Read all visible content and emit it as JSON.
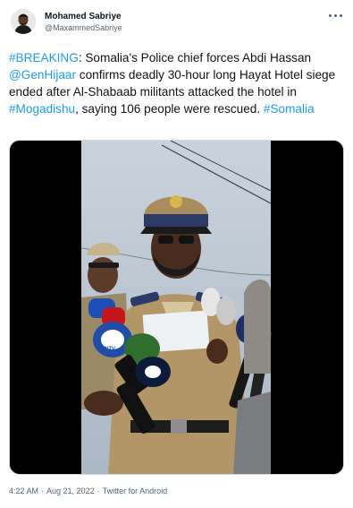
{
  "author": {
    "display_name": "Mohamed Sabriye",
    "handle": "@MaxammedSabriye",
    "avatar_icon": "avatar-portrait",
    "more_icon": "more-horizontal-icon"
  },
  "tweet": {
    "parts": [
      {
        "text": "#BREAKING",
        "kind": "hashtag"
      },
      {
        "text": ": Somalia's Police chief forces Abdi Hassan ",
        "kind": "text"
      },
      {
        "text": "@GenHijaar",
        "kind": "mention"
      },
      {
        "text": "  confirms deadly 30-hour long Hayat Hotel siege ended after Al-Shabaab militants attacked the hotel in ",
        "kind": "text"
      },
      {
        "text": "#Mogadishu",
        "kind": "hashtag"
      },
      {
        "text": ", saying 106 people were rescued. ",
        "kind": "text"
      },
      {
        "text": "#Somalia",
        "kind": "hashtag"
      }
    ]
  },
  "media": {
    "type": "video-still",
    "mic_labels": [
      "SNTV",
      "SNTV"
    ]
  },
  "footer": {
    "time": "4:22 AM",
    "separator": "·",
    "date": "Aug 21, 2022",
    "source": "Twitter for Android"
  },
  "colors": {
    "link": "#1d9bf0",
    "text": "#0f1419",
    "secondary": "#536471"
  }
}
